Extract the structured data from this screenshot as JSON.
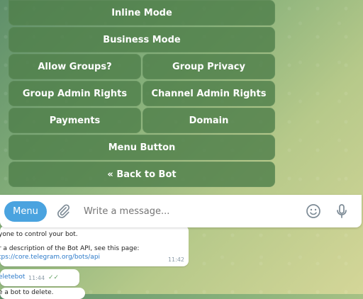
{
  "keyboard": {
    "rows": [
      [
        "Inline Mode"
      ],
      [
        "Business Mode"
      ],
      [
        "Allow Groups?",
        "Group Privacy"
      ],
      [
        "Group Admin Rights",
        "Channel Admin Rights"
      ],
      [
        "Payments",
        "Domain"
      ],
      [
        "Menu Button"
      ],
      [
        "« Back to Bot"
      ]
    ]
  },
  "composer": {
    "menu_label": "Menu",
    "placeholder": "Write a message..."
  },
  "messages": {
    "first": {
      "line1": "yone to control your bot.",
      "line2": "r a description of the Bot API, see this page:",
      "link": "tps://core.telegram.org/bots/api",
      "time": "11:42"
    },
    "second": {
      "text": "eletebot",
      "time": "11:44"
    },
    "third": {
      "text": "e a bot to delete."
    }
  }
}
